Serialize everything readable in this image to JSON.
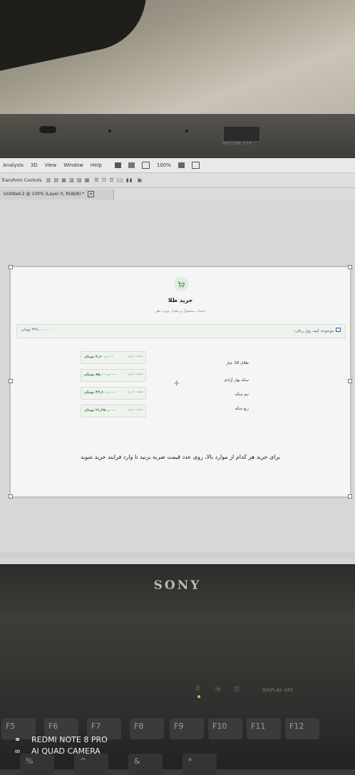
{
  "menubar": {
    "items": [
      "Analysis",
      "3D",
      "View",
      "Window",
      "Help"
    ],
    "zoom": "100%"
  },
  "optionsbar": {
    "label": "Transform Controls"
  },
  "document_tab": {
    "title": "Untitled-2 @ 100% (Layer 0, RGB/8) *"
  },
  "laptop": {
    "camera_label": "MOTION EYE",
    "brand": "SONY",
    "display_off": "DISPLAY OFF"
  },
  "page": {
    "title": "خرید طلا",
    "subtitle": "انتخاب محصول و مقدار مورد نظر",
    "wallet_label": "موجودی کیف پول ریالی:",
    "wallet_amount": "۳۹۶,۰۰۰,۰۰۰ تومان",
    "products": [
      {
        "name": "طلای 18 عیار",
        "price_label": "قیمت خرید:",
        "price": "۳,۶۰۰,۰۰۰ تومان"
      },
      {
        "name": "سکه بهار آزادی",
        "price_label": "قیمت خرید:",
        "price": "۸۵,۰۰۰,۰۰۰ تومان"
      },
      {
        "name": "نیم سکه",
        "price_label": "قیمت خرید:",
        "price": "۴۲,۶۰۰,۰۰۰ تومان"
      },
      {
        "name": "ربع سکه",
        "price_label": "قیمت خرید:",
        "price": "۲۱,۲۵۰,۰۰۰ تومان"
      }
    ],
    "instruction": "برای خرید هر کدام از موارد بالا، روی عدد قیمت ضربه بزنید تا وارد فرایند خرید شوید"
  },
  "function_keys": [
    "F5",
    "F6",
    "F7",
    "F8",
    "F9",
    "F10",
    "F11",
    "F12"
  ],
  "camera_watermark": {
    "line1": "REDMI NOTE 8 PRO",
    "line2": "AI QUAD CAMERA"
  },
  "colors": {
    "accent_green": "#2f7a3f",
    "link_blue": "#3b5ba5",
    "wallet_bg": "#eef3ec"
  }
}
